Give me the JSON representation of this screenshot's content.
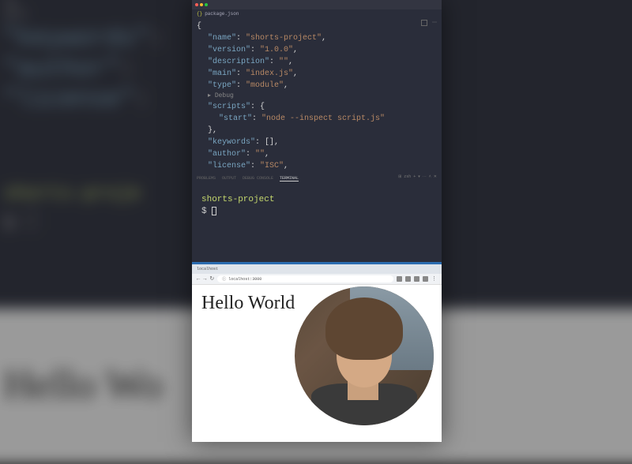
{
  "filename": "package.json",
  "json": {
    "name_key": "\"name\"",
    "name_val": "\"shorts-project\"",
    "version_key": "\"version\"",
    "version_val": "\"1.0.0\"",
    "description_key": "\"description\"",
    "description_val": "\"\"",
    "main_key": "\"main\"",
    "main_val": "\"index.js\"",
    "type_key": "\"type\"",
    "type_val": "\"module\"",
    "debug_hint": "▸ Debug",
    "scripts_key": "\"scripts\"",
    "start_key": "\"start\"",
    "start_val": "\"node --inspect script.js\"",
    "keywords_key": "\"keywords\"",
    "keywords_val": "[]",
    "author_key": "\"author\"",
    "author_val": "\"\"",
    "license_key": "\"license\"",
    "license_val": "\"ISC\""
  },
  "terminal": {
    "project": "shorts-project",
    "prompt": "$"
  },
  "panel": {
    "tabs": [
      "PROBLEMS",
      "OUTPUT",
      "DEBUG CONSOLE",
      "TERMINAL"
    ],
    "right": "⊞ zsh  +  ▾  ⋯  ˄  ✕"
  },
  "browser": {
    "tab": "localhost",
    "url": "localhost:3000",
    "heading": "Hello World"
  },
  "bg": {
    "keywords_key": "\"keywords\"",
    "author_key": "\"author\"",
    "license_key": "\"license\"",
    "terminal_project": "shorts-proje",
    "terminal_prompt": "$",
    "hello": "Hello Wo"
  }
}
